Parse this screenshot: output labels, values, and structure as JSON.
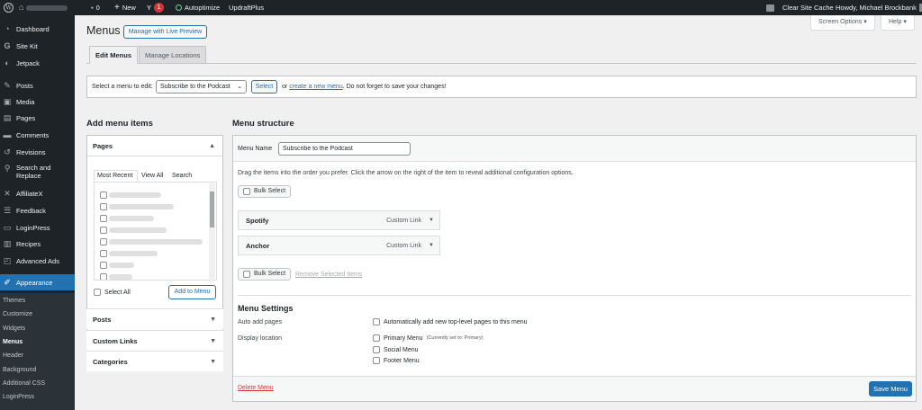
{
  "adminbar": {
    "wp_logo": "wordpress-icon",
    "comments_count": "0",
    "new_label": "New",
    "yoast_badge": "1",
    "autoptimize_label": "Autoptimize",
    "updraft_label": "UpdraftPlus",
    "clear_cache_label": "Clear Site Cache",
    "howdy_label": "Howdy, Michael Brockbank"
  },
  "sidebar": {
    "items": [
      {
        "label": "Dashboard",
        "icon": "dashboard-icon"
      },
      {
        "label": "Site Kit",
        "icon": "google-g-icon"
      },
      {
        "label": "Jetpack",
        "icon": "jetpack-icon"
      },
      {
        "label": "Posts",
        "icon": "pin-icon"
      },
      {
        "label": "Media",
        "icon": "media-icon"
      },
      {
        "label": "Pages",
        "icon": "page-icon"
      },
      {
        "label": "Comments",
        "icon": "comment-icon"
      },
      {
        "label": "Revisions",
        "icon": "history-icon"
      },
      {
        "label": "Search and",
        "label2": "Replace",
        "icon": "search-replace-icon"
      },
      {
        "label": "AffiliateX",
        "icon": "affiliatex-icon"
      },
      {
        "label": "Feedback",
        "icon": "feedback-icon"
      },
      {
        "label": "LoginPress",
        "icon": "loginpress-icon"
      },
      {
        "label": "Recipes",
        "icon": "recipes-icon"
      },
      {
        "label": "Advanced Ads",
        "icon": "ads-icon"
      },
      {
        "label": "Appearance",
        "icon": "brush-icon"
      }
    ],
    "submenu": [
      "Themes",
      "Customize",
      "Widgets",
      "Menus",
      "Header",
      "Background",
      "Additional CSS",
      "LoginPress"
    ]
  },
  "top_buttons": {
    "screen_options": "Screen Options ▾",
    "help": "Help ▾"
  },
  "page": {
    "title": "Menus",
    "live_preview": "Manage with Live Preview",
    "tabs": [
      "Edit Menus",
      "Manage Locations"
    ]
  },
  "select_bar": {
    "label": "Select a menu to edit:",
    "selected": "Subscribe to the Podcast",
    "select_button": "Select",
    "or_text": "or",
    "create_link": "create a new menu",
    "reminder": ". Do not forget to save your changes!"
  },
  "add_items": {
    "title": "Add menu items",
    "pages_title": "Pages",
    "subtabs": [
      "Most Recent",
      "View All",
      "Search"
    ],
    "select_all": "Select All",
    "add_button": "Add to Menu",
    "sections": [
      "Posts",
      "Custom Links",
      "Categories"
    ]
  },
  "structure": {
    "title": "Menu structure",
    "name_label": "Menu Name",
    "name_value": "Subscribe to the Podcast",
    "instructions": "Drag the items into the order you prefer. Click the arrow on the right of the item to reveal additional configuration options.",
    "bulk_select": "Bulk Select",
    "items": [
      {
        "title": "Spotify",
        "type": "Custom Link"
      },
      {
        "title": "Anchor",
        "type": "Custom Link"
      }
    ],
    "remove_selected": "Remove Selected Items"
  },
  "settings": {
    "title": "Menu Settings",
    "auto_add_label": "Auto add pages",
    "auto_add_option": "Automatically add new top-level pages to this menu",
    "display_label": "Display location",
    "locations": [
      {
        "name": "Primary Menu",
        "note": "(Currently set to: Primary)"
      },
      {
        "name": "Social Menu",
        "note": ""
      },
      {
        "name": "Footer Menu",
        "note": ""
      }
    ],
    "delete_link": "Delete Menu",
    "save_button": "Save Menu"
  },
  "colors": {
    "accent": "#2271b1",
    "admin_dark": "#1d2327",
    "danger": "#d63638"
  }
}
